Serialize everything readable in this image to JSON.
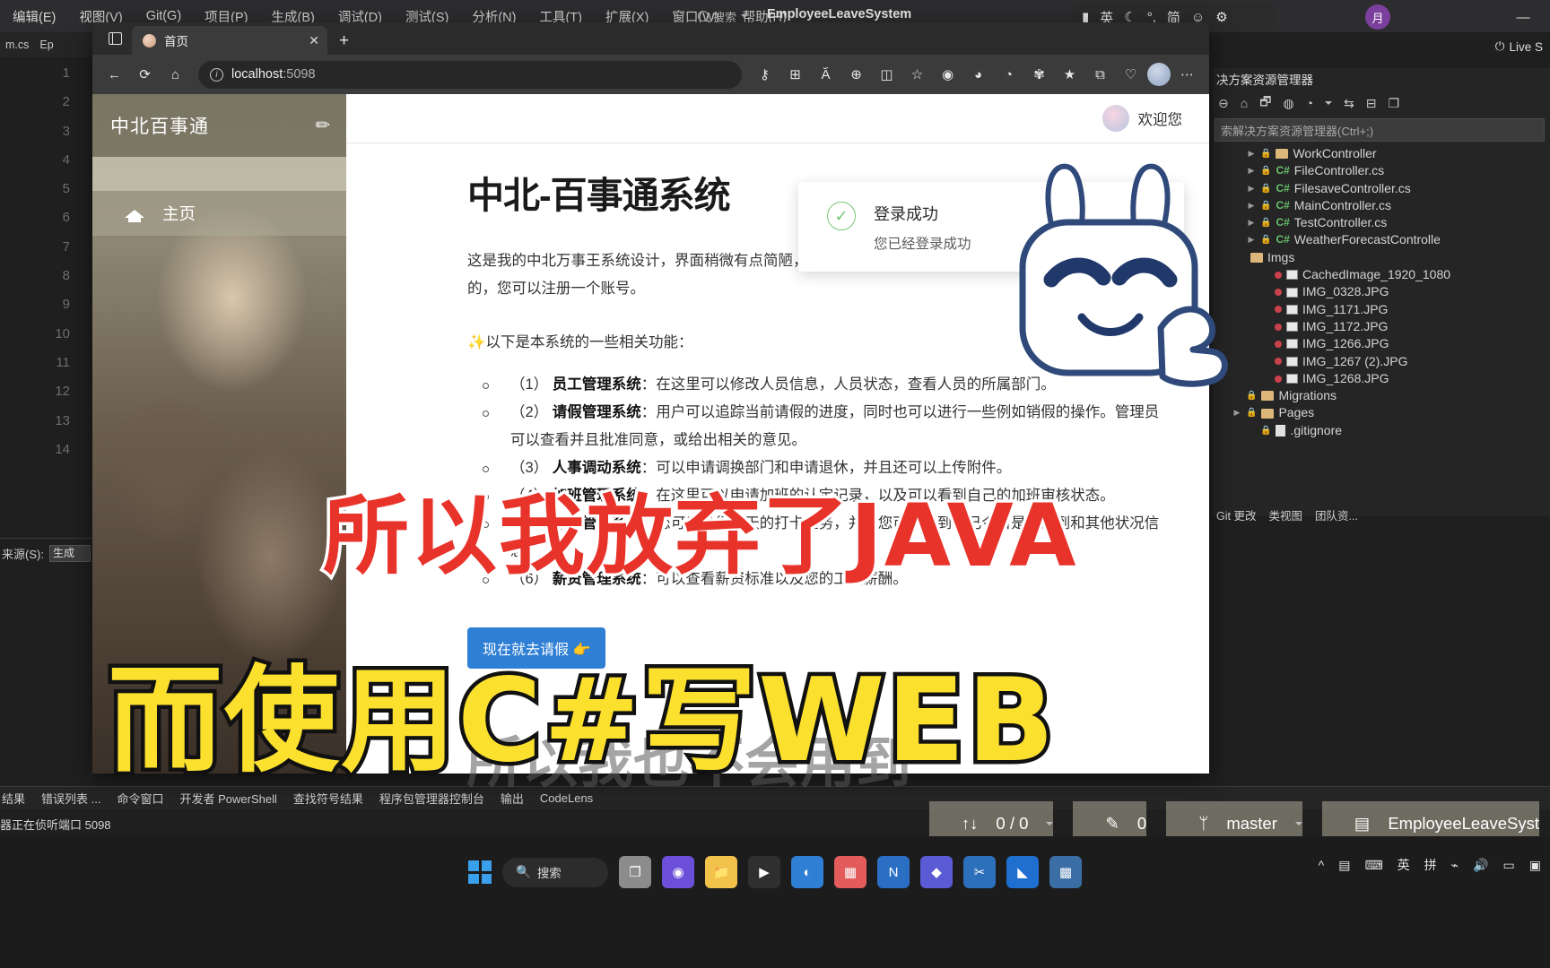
{
  "vs": {
    "menu": [
      "编辑(E)",
      "视图(V)",
      "Git(G)",
      "项目(P)",
      "生成(B)",
      "调试(D)",
      "测试(S)",
      "分析(N)",
      "工具(T)",
      "扩展(X)",
      "窗口(W)",
      "帮助(H)"
    ],
    "search_placeholder": "搜索",
    "solution_title": "EmployeeLeaveSystem",
    "user_initial": "月",
    "live_share": "Live S",
    "code_tab": "m.cs",
    "code_tab2": "Ep",
    "line_numbers": [
      "1",
      "2",
      "3",
      "4",
      "5",
      "6",
      "7",
      "8",
      "9",
      "10",
      "11",
      "12",
      "13",
      "14"
    ],
    "lower_label": "来源(S):",
    "lower_value": "生成",
    "output_tabs": [
      "结果",
      "错误列表 ...",
      "命令窗口",
      "开发者 PowerShell",
      "查找符号结果",
      "程序包管理器控制台",
      "输出",
      "CodeLens"
    ],
    "output_status": "器正在侦听端口 5098",
    "statusbar": {
      "changes": "0 / 0",
      "errors": "0",
      "branch": "master",
      "repo": "EmployeeLeaveSyst"
    }
  },
  "solution_explorer": {
    "title": "决方案资源管理器",
    "search_placeholder": "索解决方案资源管理器(Ctrl+;)",
    "tree": [
      {
        "label": "WorkController",
        "icon": "folder-icon",
        "arrow": true,
        "lock": true,
        "indent": 0
      },
      {
        "label": "FileController.cs",
        "icon": "csharp-icon",
        "arrow": true,
        "lock": true,
        "indent": 0
      },
      {
        "label": "FilesaveController.cs",
        "icon": "csharp-icon",
        "arrow": true,
        "lock": true,
        "indent": 0
      },
      {
        "label": "MainController.cs",
        "icon": "csharp-icon",
        "arrow": true,
        "lock": true,
        "indent": 0
      },
      {
        "label": "TestController.cs",
        "icon": "csharp-icon",
        "arrow": true,
        "lock": true,
        "indent": 0
      },
      {
        "label": "WeatherForecastControlle",
        "icon": "csharp-icon",
        "arrow": true,
        "lock": true,
        "indent": 0
      },
      {
        "label": "Imgs",
        "icon": "folder-icon",
        "arrow": false,
        "lock": false,
        "indent": -1
      },
      {
        "label": "CachedImage_1920_1080",
        "icon": "image-icon",
        "arrow": false,
        "lock": false,
        "dot": true,
        "indent": 1
      },
      {
        "label": "IMG_0328.JPG",
        "icon": "image-icon",
        "arrow": false,
        "lock": false,
        "dot": true,
        "indent": 1
      },
      {
        "label": "IMG_1171.JPG",
        "icon": "image-icon",
        "arrow": false,
        "lock": false,
        "dot": true,
        "indent": 1
      },
      {
        "label": "IMG_1172.JPG",
        "icon": "image-icon",
        "arrow": false,
        "lock": false,
        "dot": true,
        "indent": 1
      },
      {
        "label": "IMG_1266.JPG",
        "icon": "image-icon",
        "arrow": false,
        "lock": false,
        "dot": true,
        "indent": 1
      },
      {
        "label": "IMG_1267 (2).JPG",
        "icon": "image-icon",
        "arrow": false,
        "lock": false,
        "dot": true,
        "indent": 1
      },
      {
        "label": "IMG_1268.JPG",
        "icon": "image-icon",
        "arrow": false,
        "lock": false,
        "dot": true,
        "indent": 1
      },
      {
        "label": "Migrations",
        "icon": "folder-icon",
        "arrow": false,
        "lock": true,
        "indent": -1
      },
      {
        "label": "Pages",
        "icon": "folder-icon",
        "arrow": true,
        "lock": true,
        "indent": -1
      },
      {
        "label": ".gitignore",
        "icon": "file-icon",
        "arrow": false,
        "lock": true,
        "indent": 0
      }
    ],
    "bottom_tabs": [
      "Git 更改",
      "类视图",
      "团队资..."
    ]
  },
  "browser": {
    "tab_title": "首页",
    "url_host": "localhost",
    "url_port": ":5098",
    "new_tab_label": "+",
    "close_label": "✕"
  },
  "app": {
    "sidebar": {
      "brand": "中北百事通",
      "pin_icon": "pin-icon",
      "items": [
        {
          "label": "主页",
          "icon": "home-icon"
        }
      ]
    },
    "topbar": {
      "welcome": "欢迎您"
    },
    "heading": "中北-百事通系统",
    "lede": "这是我的中北万事王系统设计，界面稍微有点简陋，但是数据库设计部分已经全部完成了。可以正常使用的，您可以注册一个账号。",
    "features_heading": "✨以下是本系统的一些相关功能：",
    "features": [
      {
        "num": "（1）",
        "name": "员工管理系统",
        "desc": "：在这里可以修改人员信息，人员状态，查看人员的所属部门。"
      },
      {
        "num": "（2）",
        "name": "请假管理系统",
        "desc": "：用户可以追踪当前请假的进度，同时也可以进行一些例如销假的操作。管理员可以查看并且批准同意，或给出相关的意见。"
      },
      {
        "num": "（3）",
        "name": "人事调动系统",
        "desc": "：可以申请调换部门和申请退休，并且还可以上传附件。"
      },
      {
        "num": "（4）",
        "name": "加班管理系统",
        "desc": "：在这里可以申请加班的认定记录，以及可以看到自己的加班审核状态。"
      },
      {
        "num": "（5）",
        "name": "考勤管理系统",
        "desc": "：您可以进行每天的打卡任务，并且您可以看到自己今日是否迟到和其他状况信息。"
      },
      {
        "num": "（6）",
        "name": "薪资管理系统",
        "desc": "：可以查看薪资标准以及您的工资薪酬。"
      }
    ],
    "cta_label": "现在就去请假 👉",
    "toast": {
      "title": "登录成功",
      "subtitle": "您已经登录成功",
      "close_icon": "close-icon",
      "status_icon": "check-circle-icon"
    }
  },
  "subtitles": {
    "red_line": "所以我放弃了JAVA",
    "yellow_line": "而使用C#写WEB",
    "ghost_line": "所以我也不会用到"
  },
  "taskbar": {
    "search_label": "搜索",
    "ime_lang": "英",
    "ime_mode": "拼",
    "tray_items": [
      "^",
      "英",
      "拼"
    ]
  },
  "ime_bar": {
    "lang": "英",
    "moon_icon": "moon-icon",
    "punct": "简",
    "emoji_icon": "emoji-icon",
    "gear_icon": "gear-icon"
  },
  "colors": {
    "accent_blue": "#2f7fd4",
    "success_green": "#76c776",
    "subtitle_red": "#e8332a",
    "subtitle_yellow": "#fbe02e",
    "vs_bg": "#1f1f1f"
  }
}
